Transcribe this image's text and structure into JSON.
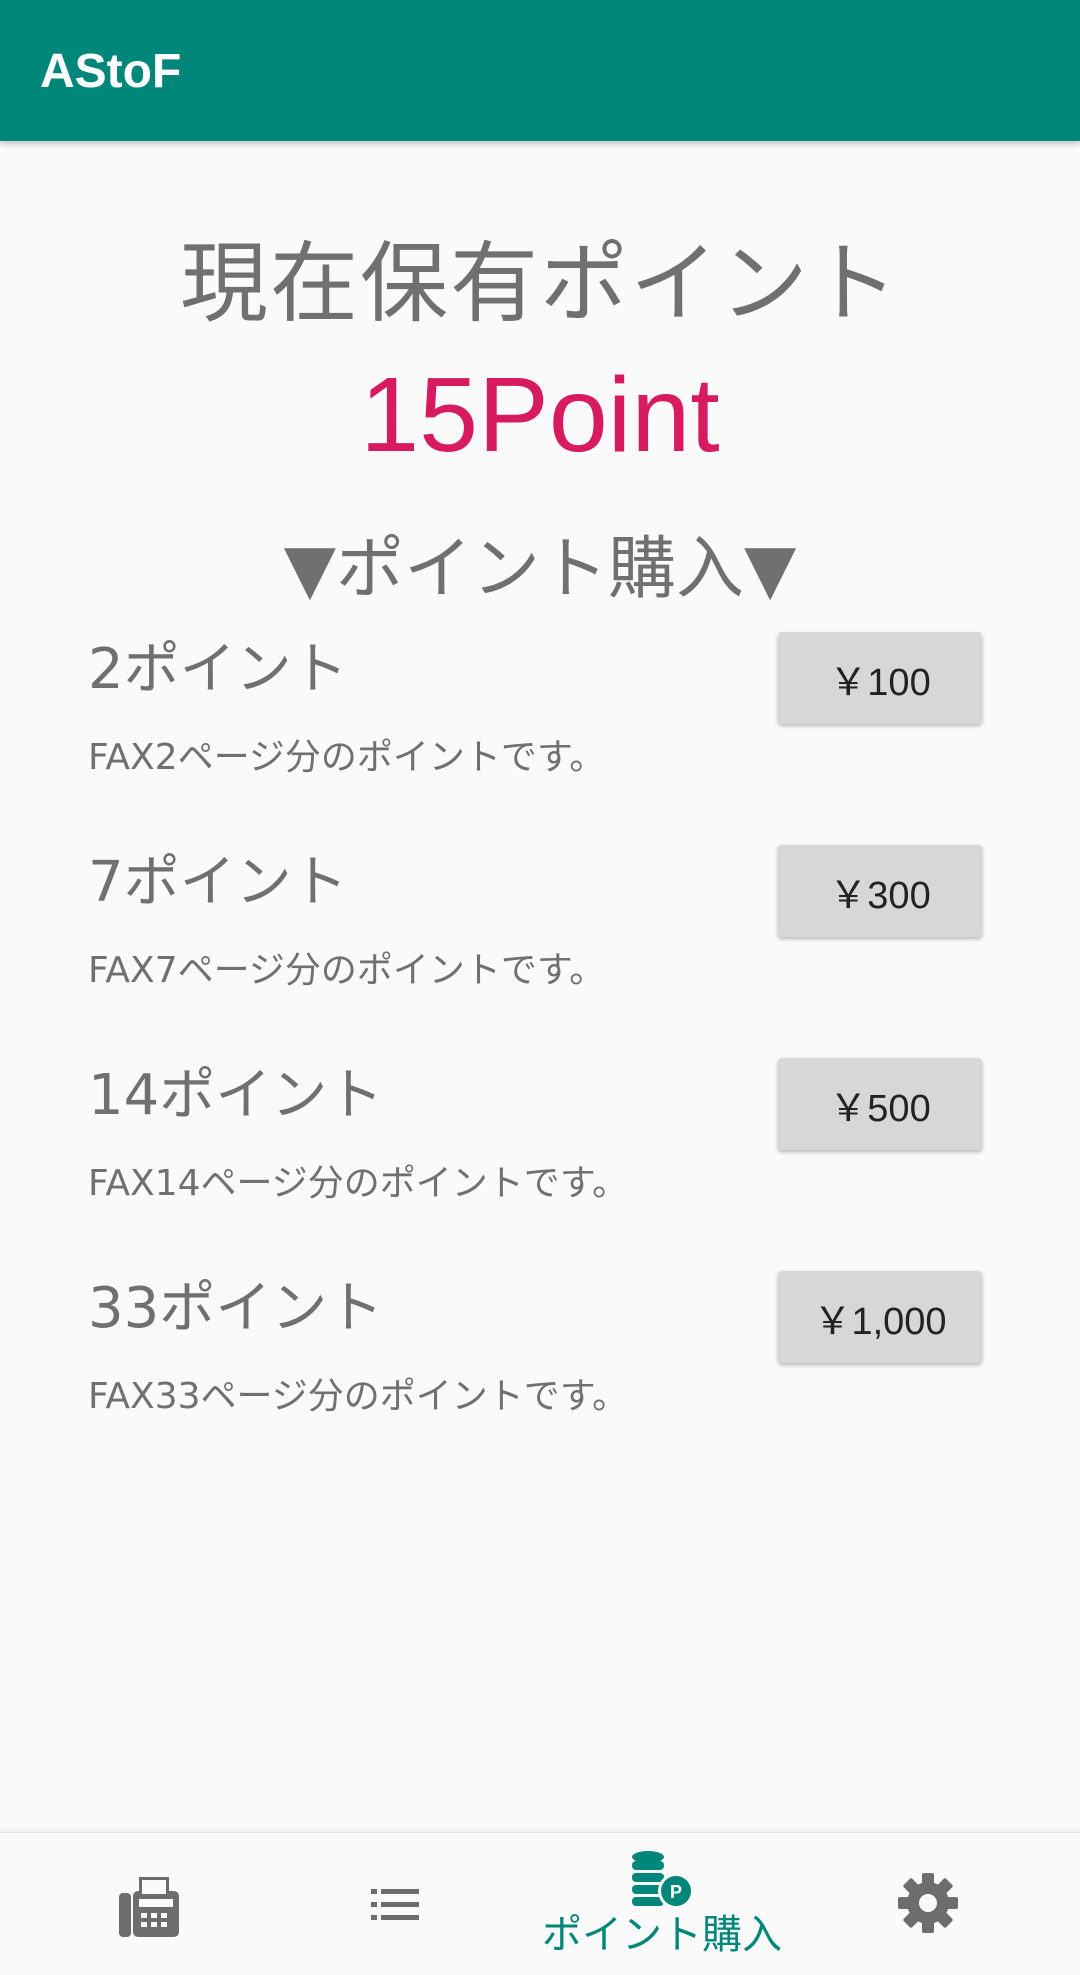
{
  "app": {
    "title": "AStoF",
    "accent_color": "#00877a",
    "points_color": "#d81b60"
  },
  "points": {
    "label": "現在保有ポイント",
    "value": "15Point"
  },
  "purchase": {
    "heading": "▼ポイント購入▼",
    "plans": [
      {
        "name": "2ポイント",
        "description": "FAX2ページ分のポイントです。",
        "price": "￥100"
      },
      {
        "name": "7ポイント",
        "description": "FAX7ページ分のポイントです。",
        "price": "￥300"
      },
      {
        "name": "14ポイント",
        "description": "FAX14ページ分のポイントです。",
        "price": "￥500"
      },
      {
        "name": "33ポイント",
        "description": "FAX33ページ分のポイントです。",
        "price": "￥1,000"
      }
    ]
  },
  "bottom_nav": {
    "items": [
      {
        "icon": "fax-icon",
        "label": ""
      },
      {
        "icon": "list-icon",
        "label": ""
      },
      {
        "icon": "coins-point-icon",
        "label": "ポイント購入",
        "active": true
      },
      {
        "icon": "gear-icon",
        "label": ""
      }
    ]
  }
}
